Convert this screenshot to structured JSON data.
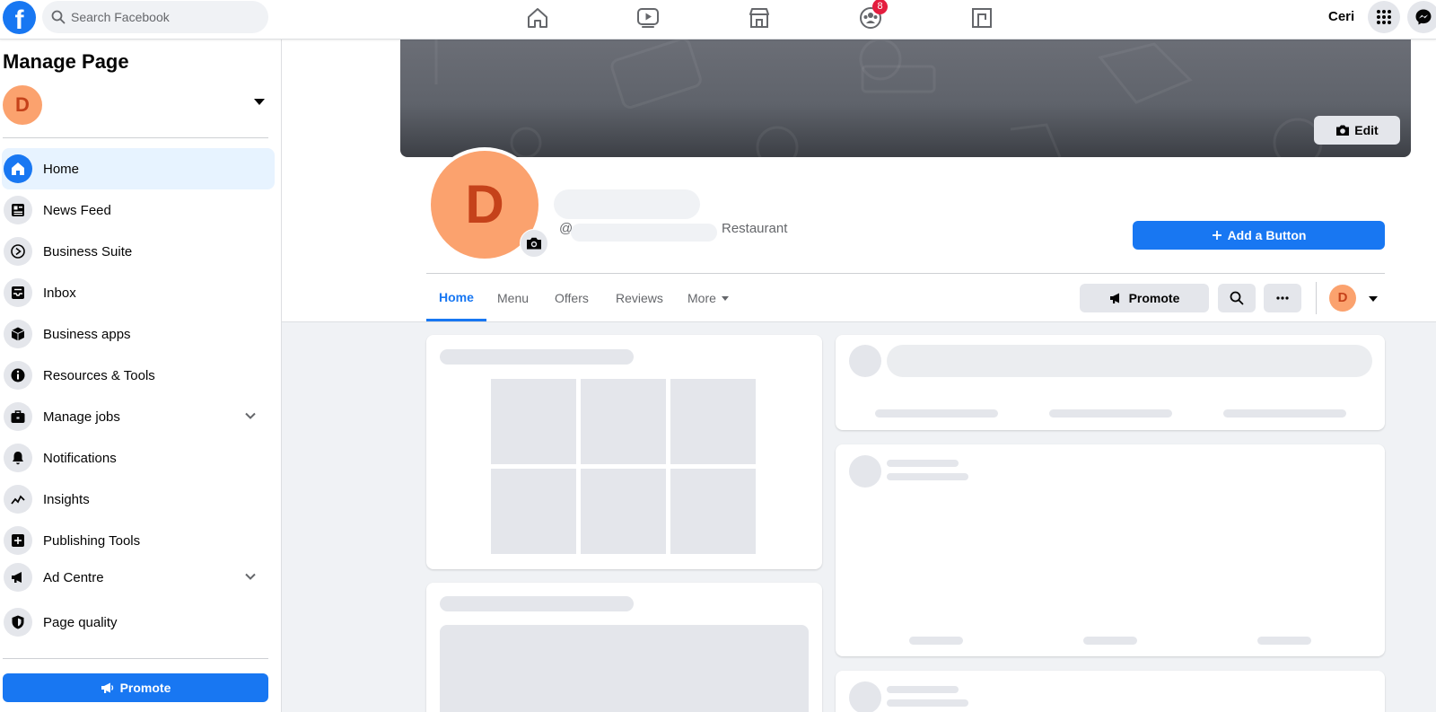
{
  "topbar": {
    "logo": "f",
    "search_placeholder": "Search Facebook",
    "nav_icons": [
      "home-icon",
      "watch-icon",
      "marketplace-icon",
      "groups-icon",
      "gaming-icon"
    ],
    "groups_badge": "8",
    "user_name": "Ceri",
    "menu_icon": "grid-menu-icon",
    "messenger_icon": "messenger-icon"
  },
  "sidebar": {
    "title": "Manage Page",
    "avatar_letter": "D",
    "items": [
      {
        "label": "Home",
        "icon": "home-icon",
        "active": true
      },
      {
        "label": "News Feed",
        "icon": "news-feed-icon"
      },
      {
        "label": "Business Suite",
        "icon": "business-suite-icon"
      },
      {
        "label": "Inbox",
        "icon": "inbox-icon"
      },
      {
        "label": "Business apps",
        "icon": "cube-icon"
      },
      {
        "label": "Resources & Tools",
        "icon": "info-icon"
      },
      {
        "label": "Manage jobs",
        "icon": "briefcase-icon",
        "expandable": true
      },
      {
        "label": "Notifications",
        "icon": "bell-icon"
      },
      {
        "label": "Insights",
        "icon": "insights-icon"
      },
      {
        "label": "Publishing Tools",
        "icon": "publishing-icon"
      },
      {
        "label": "Ad Centre",
        "icon": "megaphone-icon",
        "expandable": true
      },
      {
        "label": "Page quality",
        "icon": "shield-icon"
      }
    ],
    "promote_label": "Promote"
  },
  "profile": {
    "cover_edit_label": "Edit",
    "avatar_letter": "D",
    "handle_prefix": "@",
    "category": "Restaurant",
    "add_button_label": "Add a Button",
    "tabs": [
      {
        "label": "Home",
        "active": true
      },
      {
        "label": "Menu"
      },
      {
        "label": "Offers"
      },
      {
        "label": "Reviews"
      },
      {
        "label": "More",
        "dropdown": true
      }
    ],
    "promote_label": "Promote",
    "avatar_small_letter": "D"
  },
  "colors": {
    "brand_blue": "#1877f2",
    "avatar_orange": "#fba26e",
    "avatar_letter": "#c5421a",
    "badge_red": "#e41e3f",
    "background": "#f0f2f5"
  }
}
